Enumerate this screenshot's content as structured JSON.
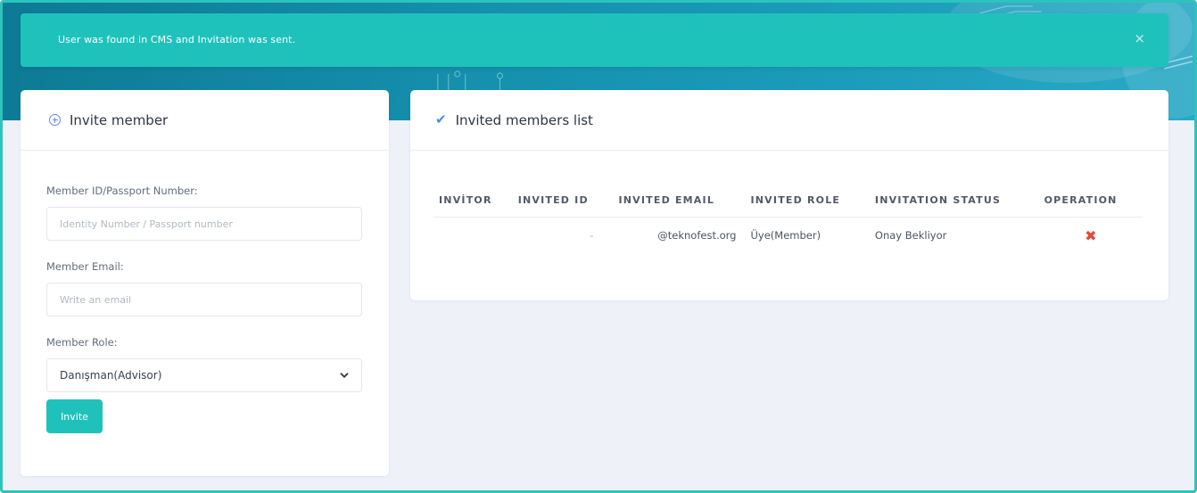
{
  "alert": {
    "message": "User was found in CMS and Invitation was sent.",
    "close_glyph": "×"
  },
  "invite_card": {
    "title": "Invite member",
    "icon": "plus-circle-icon",
    "member_id_label": "Member ID/Passport Number:",
    "member_id_placeholder": "Identity Number / Passport number",
    "member_id_value": "",
    "email_label": "Member Email:",
    "email_placeholder": "Write an email",
    "email_value": "",
    "role_label": "Member Role:",
    "role_selected": "Danışman(Advisor)",
    "invite_button": "Invite"
  },
  "members_card": {
    "title": "Invited members list",
    "icon": "check-icon",
    "columns": [
      "INVİTOR",
      "INVITED ID",
      "INVITED EMAIL",
      "INVITED ROLE",
      "INVITATION STATUS",
      "OPERATION"
    ],
    "rows": [
      {
        "invitor": "",
        "invited_id": "-",
        "invited_email": "@teknofest.org",
        "invited_role": "Üye(Member)",
        "status": "Onay Bekliyor",
        "operation_icon": "delete-x-icon"
      }
    ]
  },
  "colors": {
    "accent": "#1fc2bb",
    "banner": "#1590ad",
    "delete": "#e8453c",
    "check": "#4f8ae6"
  }
}
